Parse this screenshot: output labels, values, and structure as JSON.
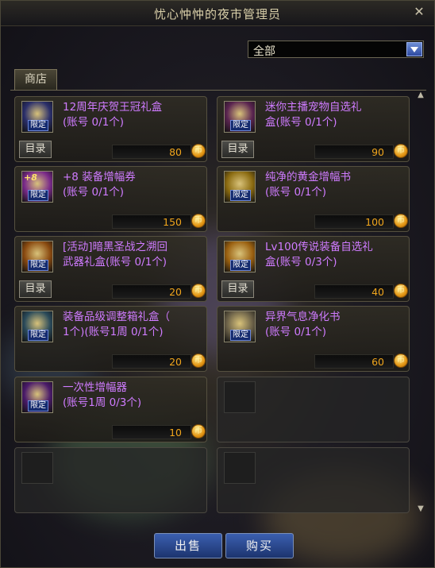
{
  "window": {
    "title": "忧心忡忡的夜市管理员",
    "close_symbol": "✕"
  },
  "filter": {
    "selected": "全部"
  },
  "tabs": [
    {
      "label": "商店"
    }
  ],
  "common": {
    "limited_badge": "限定",
    "catalog_label": "目录",
    "coin_symbol": "币"
  },
  "items": [
    {
      "name": "12周年庆贺王冠礼盒\n(账号 0/1个)",
      "price": "80",
      "catalog": true,
      "icon": "crown-gift-box-icon",
      "color": "#2a2e6a"
    },
    {
      "name": "迷你主播宠物自选礼\n盒(账号 0/1个)",
      "price": "90",
      "catalog": true,
      "icon": "pet-gift-box-icon",
      "color": "#5a2450"
    },
    {
      "name": "+8 装备增幅券\n(账号 0/1个)",
      "price": "150",
      "catalog": false,
      "icon": "amplify-ticket-icon",
      "color": "#7a2a8a",
      "badge_text": "+8"
    },
    {
      "name": "纯净的黄金增幅书\n(账号 0/1个)",
      "price": "100",
      "catalog": false,
      "icon": "golden-book-icon",
      "color": "#8a6a10"
    },
    {
      "name": "[活动]暗黑圣战之溯回\n武器礼盒(账号 0/1个)",
      "price": "20",
      "catalog": true,
      "icon": "weapon-gift-box-icon",
      "color": "#8a4a10"
    },
    {
      "name": "Lv100传说装备自选礼\n盒(账号 0/3个)",
      "price": "40",
      "catalog": true,
      "icon": "legendary-gift-box-icon",
      "color": "#9a6010"
    },
    {
      "name": "装备品级调整箱礼盒（\n1个)(账号1周 0/1个)",
      "price": "20",
      "catalog": false,
      "icon": "grade-box-icon",
      "color": "#2a4a5a"
    },
    {
      "name": "异界气息净化书\n(账号 0/1个)",
      "price": "60",
      "catalog": false,
      "icon": "purify-book-icon",
      "color": "#6a6048"
    },
    {
      "name": "一次性增幅器\n(账号1周 0/3个)",
      "price": "10",
      "catalog": false,
      "icon": "amplifier-icon",
      "color": "#4a1a6a"
    }
  ],
  "empty_slots": 3,
  "buttons": {
    "sell": "出售",
    "buy": "购买"
  }
}
